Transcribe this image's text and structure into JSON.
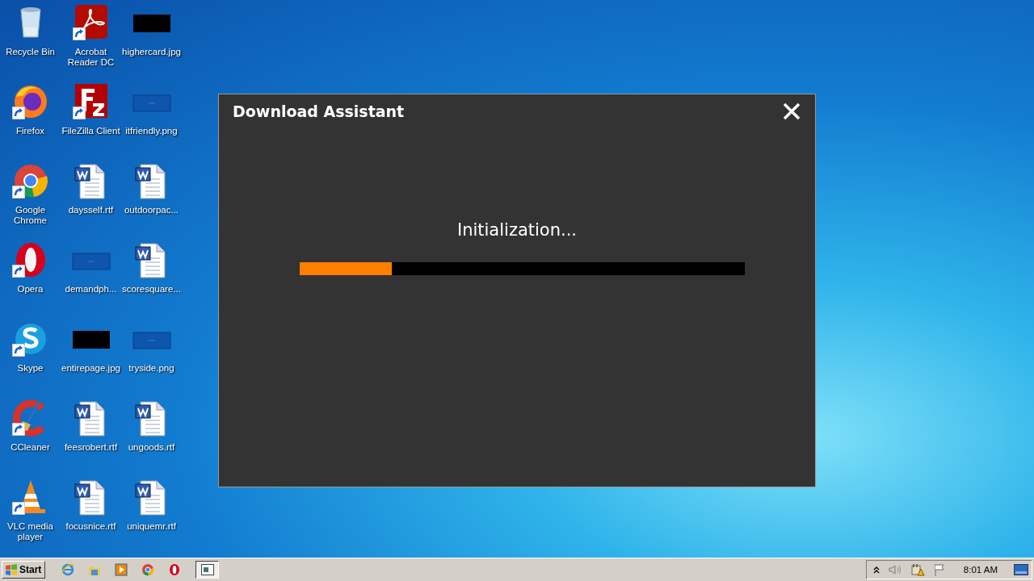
{
  "desktop": {
    "icons": [
      {
        "label": "Recycle Bin",
        "kind": "recycle",
        "shortcut": false
      },
      {
        "label": "Acrobat Reader DC",
        "kind": "acrobat",
        "shortcut": true
      },
      {
        "label": "highercard.jpg",
        "kind": "image-dark",
        "shortcut": false
      },
      {
        "label": "Firefox",
        "kind": "firefox",
        "shortcut": true
      },
      {
        "label": "FileZilla Client",
        "kind": "filezilla",
        "shortcut": true
      },
      {
        "label": "itfriendly.png",
        "kind": "image-blank",
        "shortcut": false
      },
      {
        "label": "Google Chrome",
        "kind": "chrome",
        "shortcut": true
      },
      {
        "label": "daysself.rtf",
        "kind": "doc",
        "shortcut": false
      },
      {
        "label": "outdoorpac...",
        "kind": "doc",
        "shortcut": false
      },
      {
        "label": "Opera",
        "kind": "opera",
        "shortcut": true
      },
      {
        "label": "demandph...",
        "kind": "image-blank",
        "shortcut": false
      },
      {
        "label": "scoresquare...",
        "kind": "doc",
        "shortcut": false
      },
      {
        "label": "Skype",
        "kind": "skype",
        "shortcut": true
      },
      {
        "label": "entirepage.jpg",
        "kind": "image-dark",
        "shortcut": false
      },
      {
        "label": "tryside.png",
        "kind": "image-blank",
        "shortcut": false
      },
      {
        "label": "CCleaner",
        "kind": "ccleaner",
        "shortcut": true
      },
      {
        "label": "feesrobert.rtf",
        "kind": "doc",
        "shortcut": false
      },
      {
        "label": "ungoods.rtf",
        "kind": "doc",
        "shortcut": false
      },
      {
        "label": "VLC media player",
        "kind": "vlc",
        "shortcut": true
      },
      {
        "label": "focusnice.rtf",
        "kind": "doc",
        "shortcut": false
      },
      {
        "label": "uniquemr.rtf",
        "kind": "doc",
        "shortcut": false
      }
    ]
  },
  "dialog": {
    "title": "Download Assistant",
    "status": "Initialization...",
    "progress": {
      "level": 0.207
    }
  },
  "taskbar": {
    "start": "Start",
    "quick_launch": [
      {
        "kind": "ie"
      },
      {
        "kind": "explorer"
      },
      {
        "kind": "media"
      },
      {
        "kind": "chrome"
      },
      {
        "kind": "opera"
      }
    ],
    "tasks": [
      {
        "kind": "window",
        "selected": true
      }
    ],
    "tray": {
      "clock": "8:01 AM"
    }
  }
}
